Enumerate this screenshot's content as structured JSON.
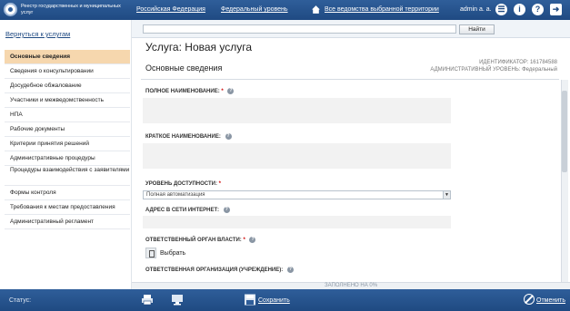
{
  "header": {
    "registry_title": "Реестр государственных и муниципальных услуг",
    "links": [
      "Российская Федерация",
      "Федеральный уровень",
      "Все ведомства выбранной территории"
    ],
    "user": "admin a. a."
  },
  "search": {
    "button_label": "Найти",
    "value": ""
  },
  "sidebar": {
    "back_link": "Вернуться к услугам",
    "items": [
      "Основные сведения",
      "Сведения о консультировании",
      "Досудебное обжалование",
      "Участники и межведомственность",
      "НПА",
      "Рабочие документы",
      "Критерии принятия решений",
      "Административные процедуры",
      "Процедуры взаимодействия с заявителями",
      "Формы контроля",
      "Требования к местам предоставления",
      "Административный регламент"
    ]
  },
  "main": {
    "page_title": "Услуга: Новая услуга",
    "section_title": "Основные сведения",
    "identifier": "ИДЕНТИФИКАТОР: 161784588",
    "admin_level": "АДМИНИСТРАТИВНЫЙ УРОВЕНЬ: Федеральный",
    "fields": {
      "full_name": "ПОЛНОЕ НАИМЕНОВАНИЕ:",
      "short_name": "КРАТКОЕ НАИМЕНОВАНИЕ:",
      "access_level": "УРОВЕНЬ ДОСТУПНОСТИ:",
      "access_level_value": "Полная автоматизация",
      "web_address": "АДРЕС В СЕТИ ИНТЕРНЕТ:",
      "authority": "ОТВЕТСТВЕННЫЙ ОРГАН ВЛАСТИ:",
      "choose": "Выбрать",
      "organization": "ОТВЕТСТВЕННАЯ ОРГАНИЗАЦИЯ (УЧРЕЖДЕНИЕ):"
    },
    "required_mark": "*"
  },
  "footer": {
    "progress": "ЗАПОЛНЕНО НА 0%",
    "status_label": "Статус:",
    "save_label": "Сохранить",
    "cancel_label": "Отменить"
  }
}
